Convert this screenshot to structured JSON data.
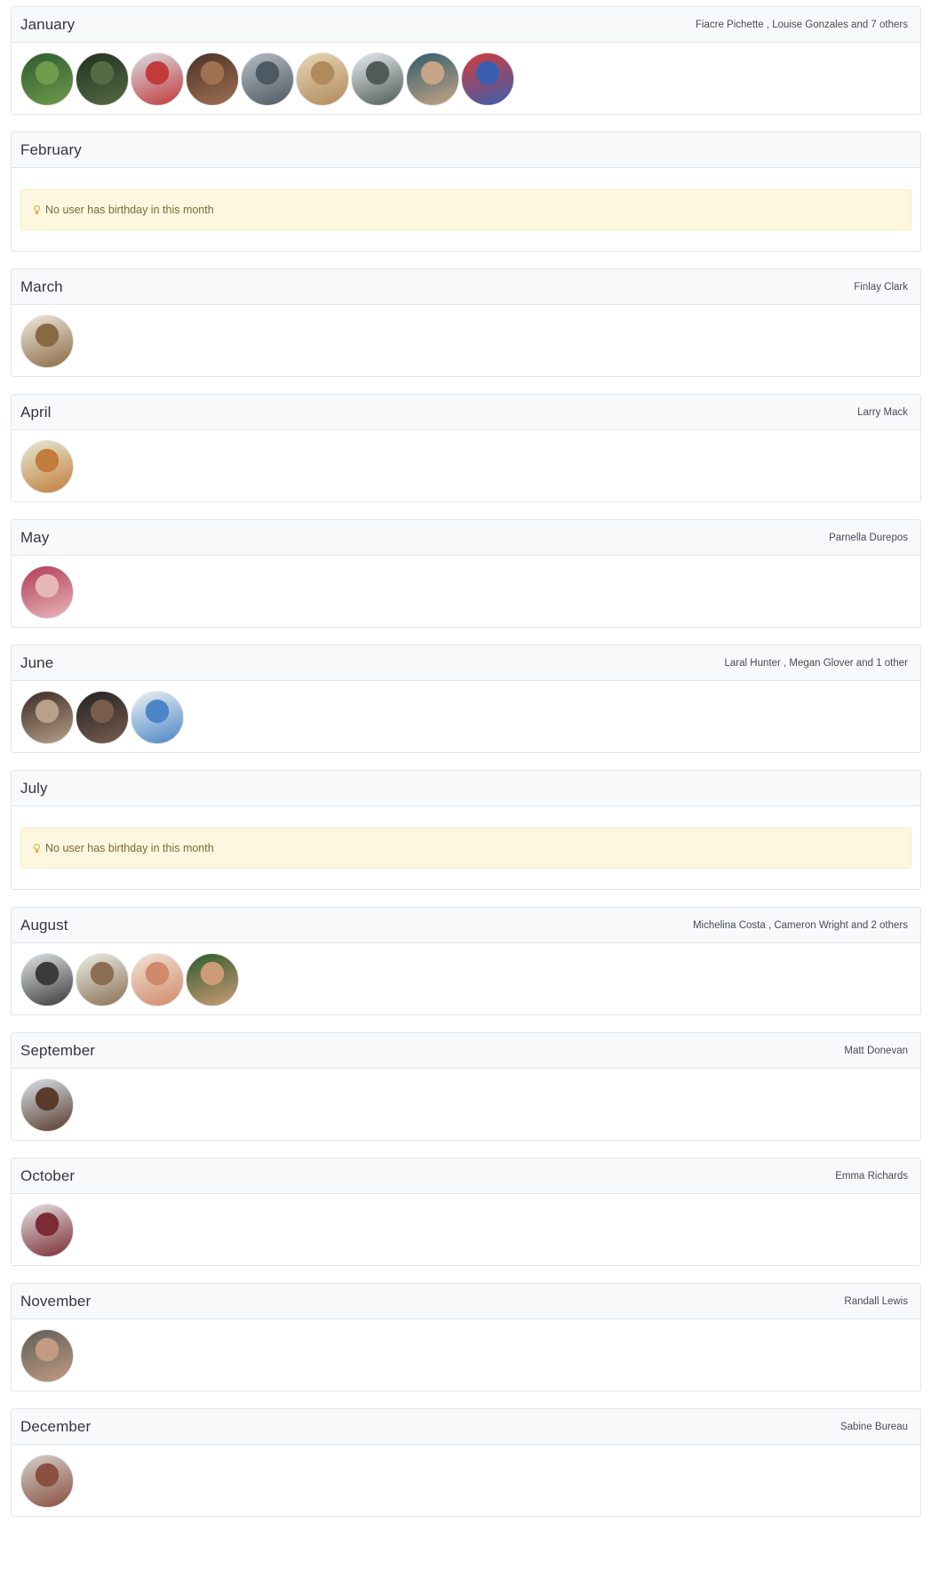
{
  "months": [
    {
      "name": "January",
      "people": "Fiacre Pichette , Louise Gonzales and 7 others",
      "avatars": [
        {
          "colors": [
            "#2e5b2d",
            "#6e9b4c"
          ]
        },
        {
          "colors": [
            "#22301f",
            "#556b45"
          ]
        },
        {
          "colors": [
            "#d8dee4",
            "#c23a3a"
          ]
        },
        {
          "colors": [
            "#4a3227",
            "#a07052"
          ]
        },
        {
          "colors": [
            "#b5bcc3",
            "#4d5a63"
          ]
        },
        {
          "colors": [
            "#e8d6b8",
            "#b08a5a"
          ]
        },
        {
          "colors": [
            "#e6ebef",
            "#4f5b55"
          ]
        },
        {
          "colors": [
            "#2f5d6a",
            "#c6a486"
          ]
        },
        {
          "colors": [
            "#d43b3b",
            "#3a5fb0"
          ]
        }
      ],
      "empty_message": ""
    },
    {
      "name": "February",
      "people": "",
      "avatars": [],
      "empty_message": "No user has birthday in this month"
    },
    {
      "name": "March",
      "people": "Finlay Clark",
      "avatars": [
        {
          "colors": [
            "#efe8de",
            "#8a6a42"
          ]
        }
      ],
      "empty_message": ""
    },
    {
      "name": "April",
      "people": "Larry Mack",
      "avatars": [
        {
          "colors": [
            "#e4ead7",
            "#c37c3a"
          ]
        }
      ],
      "empty_message": ""
    },
    {
      "name": "May",
      "people": "Parnella Durepos",
      "avatars": [
        {
          "colors": [
            "#b23a5a",
            "#e7b7b8"
          ]
        }
      ],
      "empty_message": ""
    },
    {
      "name": "June",
      "people": "Laral Hunter , Megan Glover and 1 other",
      "avatars": [
        {
          "colors": [
            "#3b2a24",
            "#b8a08a"
          ]
        },
        {
          "colors": [
            "#1f2324",
            "#7a5c4e"
          ]
        },
        {
          "colors": [
            "#eef0f2",
            "#4a86c6"
          ]
        }
      ],
      "empty_message": ""
    },
    {
      "name": "July",
      "people": "",
      "avatars": [],
      "empty_message": "No user has birthday in this month"
    },
    {
      "name": "August",
      "people": "Michelina Costa , Cameron Wright and 2 others",
      "avatars": [
        {
          "colors": [
            "#dfe3e5",
            "#3a3c3a"
          ]
        },
        {
          "colors": [
            "#e9efe4",
            "#8b6f55"
          ]
        },
        {
          "colors": [
            "#f2e2d6",
            "#d08a6a"
          ]
        },
        {
          "colors": [
            "#2c5b2a",
            "#cc9c78"
          ]
        }
      ],
      "empty_message": ""
    },
    {
      "name": "September",
      "people": "Matt Donevan",
      "avatars": [
        {
          "colors": [
            "#d7e2ea",
            "#5a3a2a"
          ]
        }
      ],
      "empty_message": ""
    },
    {
      "name": "October",
      "people": "Emma Richards",
      "avatars": [
        {
          "colors": [
            "#e2e2e2",
            "#7c2b34"
          ]
        }
      ],
      "empty_message": ""
    },
    {
      "name": "November",
      "people": "Randall Lewis",
      "avatars": [
        {
          "colors": [
            "#5c5f5a",
            "#c39a82"
          ]
        }
      ],
      "empty_message": ""
    },
    {
      "name": "December",
      "people": "Sabine Bureau",
      "avatars": [
        {
          "colors": [
            "#d4cfc8",
            "#8a5040"
          ]
        }
      ],
      "empty_message": ""
    }
  ]
}
